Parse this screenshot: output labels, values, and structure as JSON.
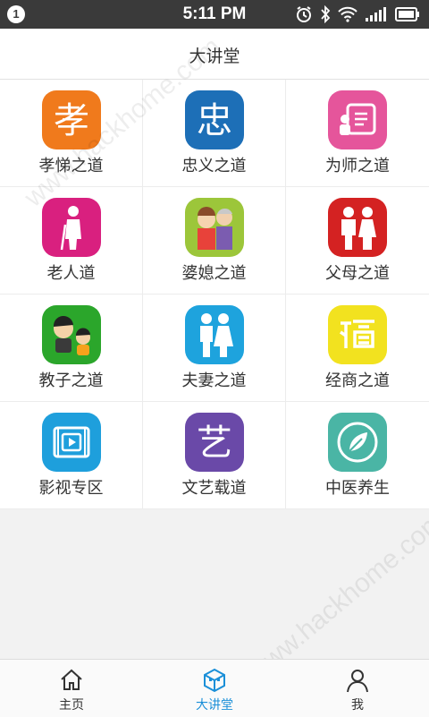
{
  "status_bar": {
    "notification_count": "1",
    "time": "5:11 PM"
  },
  "header": {
    "title": "大讲堂"
  },
  "grid_items": [
    {
      "label": "孝悌之道",
      "icon": "xiao-character-icon",
      "color": "#f07a1c",
      "glyph": "孝"
    },
    {
      "label": "忠义之道",
      "icon": "zhong-character-icon",
      "color": "#1d6fb7",
      "glyph": "忠"
    },
    {
      "label": "为师之道",
      "icon": "teacher-icon",
      "color": "#e5559b"
    },
    {
      "label": "老人道",
      "icon": "elder-icon",
      "color": "#d9207f"
    },
    {
      "label": "婆媳之道",
      "icon": "mother-daughter-in-law-icon",
      "color": "#9cc63a"
    },
    {
      "label": "父母之道",
      "icon": "parents-icon",
      "color": "#d42222"
    },
    {
      "label": "教子之道",
      "icon": "children-icon",
      "color": "#2ba62b"
    },
    {
      "label": "夫妻之道",
      "icon": "couple-icon",
      "color": "#1ea3dd"
    },
    {
      "label": "经商之道",
      "icon": "commerce-icon",
      "color": "#f2e21f"
    },
    {
      "label": "影视专区",
      "icon": "film-icon",
      "color": "#1e9fdc"
    },
    {
      "label": "文艺载道",
      "icon": "yi-character-icon",
      "color": "#6a49a8",
      "glyph": "艺"
    },
    {
      "label": "中医养生",
      "icon": "leaf-icon",
      "color": "#4ab5a5"
    }
  ],
  "tab_bar": {
    "tabs": [
      {
        "label": "主页",
        "icon": "home-icon"
      },
      {
        "label": "大讲堂",
        "icon": "cube-icon",
        "active": true
      },
      {
        "label": "我",
        "icon": "user-icon"
      }
    ]
  },
  "watermark": "www.hackhome.com",
  "colors": {
    "accent": "#1a8fd8",
    "status_bar": "#3a3a3a"
  }
}
